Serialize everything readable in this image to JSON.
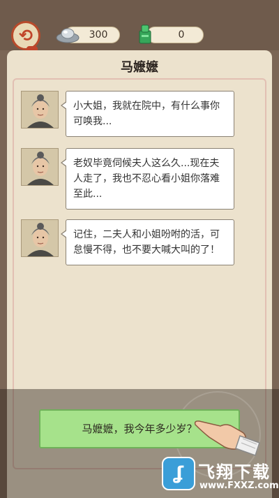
{
  "header": {
    "back_icon": "back-swirl-icon",
    "silver": {
      "icon": "silver-ingot-icon",
      "value": "300"
    },
    "jade": {
      "icon": "jade-block-icon",
      "value": "0"
    }
  },
  "dialog": {
    "title": "马嬷嬷",
    "messages": [
      {
        "avatar": "old-woman-portrait",
        "text": "小大姐，我就在院中，有什么事你可唤我..."
      },
      {
        "avatar": "old-woman-portrait",
        "text": "老奴毕竟伺候夫人这么久...现在夫人走了，我也不忍心看小姐你落难至此..."
      },
      {
        "avatar": "old-woman-portrait",
        "text": "记住，二夫人和小姐吩咐的活，可怠慢不得，也不要大喊大叫的了！"
      }
    ]
  },
  "option": {
    "label": "马嬷嬷，我今年多少岁？",
    "pointer_icon": "pointing-hand-icon"
  },
  "watermark": {
    "title": "飞翔下载",
    "url": "www.FXXZ.com"
  },
  "colors": {
    "option_green": "#a6e28b",
    "panel": "#ece2cd",
    "accent_red": "#c0442a"
  }
}
